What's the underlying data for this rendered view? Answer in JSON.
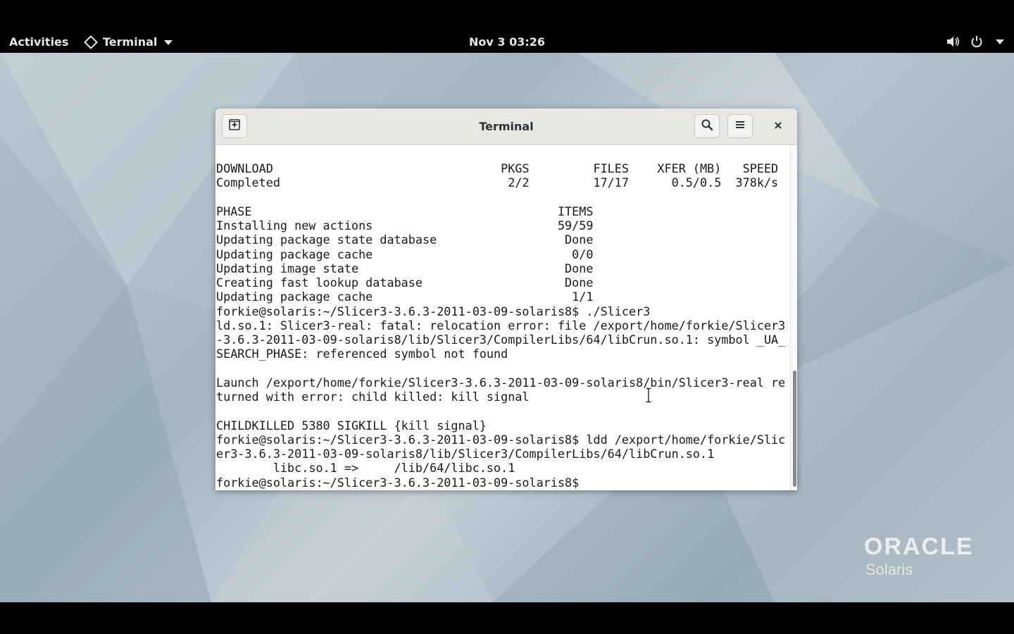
{
  "topbar": {
    "activities": "Activities",
    "app_name": "Terminal",
    "clock": "Nov 3  03:26",
    "icons": [
      "volume-icon",
      "power-icon",
      "chevron-down-icon"
    ]
  },
  "window": {
    "title": "Terminal",
    "buttons": [
      "new-tab-icon",
      "search-icon",
      "hamburger-menu-icon",
      "close-icon"
    ]
  },
  "terminal": {
    "lines": [
      "DOWNLOAD                                PKGS         FILES    XFER (MB)   SPEED",
      "Completed                                2/2         17/17      0.5/0.5  378k/s",
      "",
      "PHASE                                           ITEMS",
      "Installing new actions                          59/59",
      "Updating package state database                  Done",
      "Updating package cache                            0/0",
      "Updating image state                             Done",
      "Creating fast lookup database                    Done",
      "Updating package cache                            1/1",
      "forkie@solaris:~/Slicer3-3.6.3-2011-03-09-solaris8$ ./Slicer3",
      "ld.so.1: Slicer3-real: fatal: relocation error: file /export/home/forkie/Slicer3",
      "-3.6.3-2011-03-09-solaris8/lib/Slicer3/CompilerLibs/64/libCrun.so.1: symbol _UA_",
      "SEARCH_PHASE: referenced symbol not found",
      "",
      "Launch /export/home/forkie/Slicer3-3.6.3-2011-03-09-solaris8/bin/Slicer3-real re",
      "turned with error: child killed: kill signal",
      "",
      "CHILDKILLED 5380 SIGKILL {kill signal}",
      "forkie@solaris:~/Slicer3-3.6.3-2011-03-09-solaris8$ ldd /export/home/forkie/Slic",
      "er3-3.6.3-2011-03-09-solaris8/lib/Slicer3/CompilerLibs/64/libCrun.so.1",
      "        libc.so.1 =>     /lib/64/libc.so.1",
      "forkie@solaris:~/Slicer3-3.6.3-2011-03-09-solaris8$ "
    ]
  },
  "branding": {
    "name": "ORACLE",
    "product": "Solaris"
  },
  "colors": {
    "topbar": "#000000",
    "headerbar": "#e9e7e4",
    "terminal_bg": "#ffffff",
    "terminal_fg": "#1a1a1a"
  }
}
